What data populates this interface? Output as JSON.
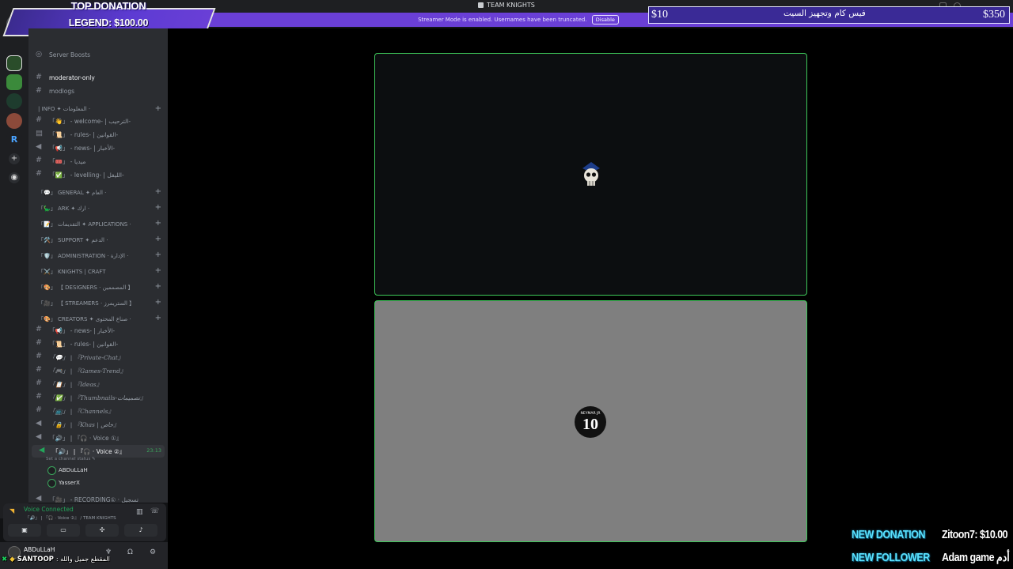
{
  "window": {
    "title": "TEAM KNIGHTS"
  },
  "streamer_banner": {
    "text": "Streamer Mode is enabled. Usernames have been truncated.",
    "button": "Disable"
  },
  "top_donation": {
    "label": "TOP DONATION",
    "value": "LEGEND: $100.00"
  },
  "ticker": {
    "left": "$10",
    "middle": "فيس كام وتجهيز السيت",
    "right": "$350"
  },
  "sidebar": {
    "server_boosts": "Server Boosts",
    "moderator": "moderator-only",
    "modlogs": "modlogs",
    "info_category": "| INFO ✦ المعلومات ·",
    "info_channels": [
      "「👋」 - welcome- | الترحيب-",
      "「📜」 - rules- | القوانين-",
      "「📢」 - news- | الأخبار-",
      "「🎟️」 - ميديا",
      "「✅」 - levelling- | الليفل-"
    ],
    "categories": [
      "「💬」 GENERAL ✦ العام ·",
      "「🦕」 ARK ✦ ارك ·",
      "「📝」 التقديمات ✦ APPLICATIONS ·",
      "「🛠️」 SUPPORT ✦ الدعم ·",
      "「🛡️」 ADMINISTRATION · الإدارة ·",
      "「⚔️」 KNIGHTS | CRAFT",
      "「🎨」 【 DESIGNERS · المصممين 】",
      "「🎥」 【 STREAMERS · الستريمرز 】",
      "「🎨」 CREATORS ✦ صناع المحتوى ·"
    ],
    "creator_channels": [
      "「📢」 - news- | الأخبار-",
      "「📜」 - rules- | القوانين-",
      "「💬」 | 『Private-Chat』",
      "「🎮」 | 『Games-Trend』",
      "「📋」 | 『Ideas』",
      "「✅」 | 『Thumbnails-تصميمات』",
      "「📺」 | 『Channels』",
      "「🔒」 | 『Khas | خاص』"
    ],
    "voice_1": "「🔊」 | 『🎧 · Voice ①』",
    "voice_2": "「🔊」 | 『🎧 · Voice ②』",
    "voice_2_time": "23:13",
    "voice_2_status": "Set a channel status ✎",
    "members": [
      "ABDuLLaH",
      "YasserX"
    ],
    "recording": "「🎥」 - RECORDING① · تسجيل"
  },
  "voice_panel": {
    "status": "Voice Connected",
    "subtitle": "「🔊」 | 『🎧 · Voice ②』 / TEAM KNIGHTS"
  },
  "user_panel": {
    "name": "ABDuLLaH"
  },
  "bottom_overlay": {
    "prefix": "✖",
    "name": "SANTOOP",
    "message": ": المقطع جميل والله"
  },
  "tile_badge": {
    "small": "NEYMAR JR",
    "number": "10"
  },
  "alerts": [
    {
      "label": "NEW DONATION",
      "value": "Zitoon7: $10.00"
    },
    {
      "label": "NEW FOLLOWER",
      "value": "Adam game أدم"
    }
  ]
}
